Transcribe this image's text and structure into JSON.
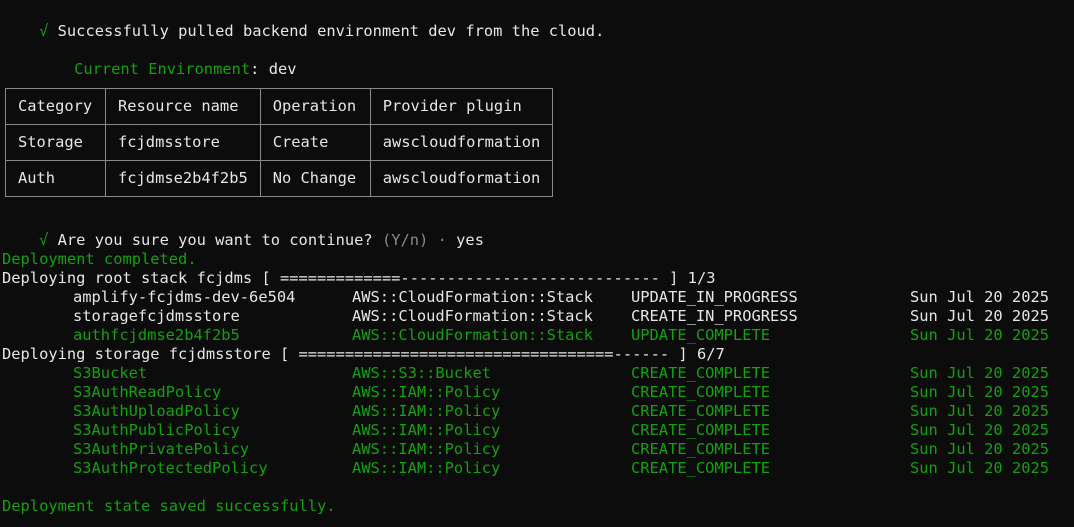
{
  "pull_message": "Successfully pulled backend environment dev from the cloud.",
  "check_glyph": "√",
  "current_env": {
    "label": "Current Environment",
    "separator": ":",
    "value": "dev"
  },
  "table": {
    "headers": [
      "Category",
      "Resource name",
      "Operation",
      "Provider plugin"
    ],
    "rows": [
      [
        "Storage",
        "fcjdmsstore",
        "Create",
        "awscloudformation"
      ],
      [
        "Auth",
        "fcjdmse2b4f2b5",
        "No Change",
        "awscloudformation"
      ]
    ]
  },
  "prompt": {
    "question": "Are you sure you want to continue?",
    "hint": "(Y/n)",
    "dot": "·",
    "answer": "yes"
  },
  "deployment_completed": "Deployment completed.",
  "root_stack": {
    "label": "Deploying root stack fcjdms [ =============---------------------------- ] 1/3",
    "progress": "1/3",
    "rows": [
      {
        "name": "amplify-fcjdms-dev-6e504",
        "type": "AWS::CloudFormation::Stack",
        "status": "UPDATE_IN_PROGRESS",
        "date": "Sun Jul 20 2025",
        "complete": false
      },
      {
        "name": "storagefcjdmsstore",
        "type": "AWS::CloudFormation::Stack",
        "status": "CREATE_IN_PROGRESS",
        "date": "Sun Jul 20 2025",
        "complete": false
      },
      {
        "name": "authfcjdmse2b4f2b5",
        "type": "AWS::CloudFormation::Stack",
        "status": "UPDATE_COMPLETE",
        "date": "Sun Jul 20 2025",
        "complete": true
      }
    ]
  },
  "storage_stack": {
    "label": "Deploying storage fcjdmsstore [ ==================================------ ] 6/7",
    "progress": "6/7",
    "rows": [
      {
        "name": "S3Bucket",
        "type": "AWS::S3::Bucket",
        "status": "CREATE_COMPLETE",
        "date": "Sun Jul 20 2025"
      },
      {
        "name": "S3AuthReadPolicy",
        "type": "AWS::IAM::Policy",
        "status": "CREATE_COMPLETE",
        "date": "Sun Jul 20 2025"
      },
      {
        "name": "S3AuthUploadPolicy",
        "type": "AWS::IAM::Policy",
        "status": "CREATE_COMPLETE",
        "date": "Sun Jul 20 2025"
      },
      {
        "name": "S3AuthPublicPolicy",
        "type": "AWS::IAM::Policy",
        "status": "CREATE_COMPLETE",
        "date": "Sun Jul 20 2025"
      },
      {
        "name": "S3AuthPrivatePolicy",
        "type": "AWS::IAM::Policy",
        "status": "CREATE_COMPLETE",
        "date": "Sun Jul 20 2025"
      },
      {
        "name": "S3AuthProtectedPolicy",
        "type": "AWS::IAM::Policy",
        "status": "CREATE_COMPLETE",
        "date": "Sun Jul 20 2025"
      }
    ]
  },
  "state_saved": "Deployment state saved successfully.",
  "colors": {
    "success": "#13a10e",
    "text": "#e6e6e6",
    "dim": "#8a8a8a",
    "background": "#0c0c0c"
  }
}
